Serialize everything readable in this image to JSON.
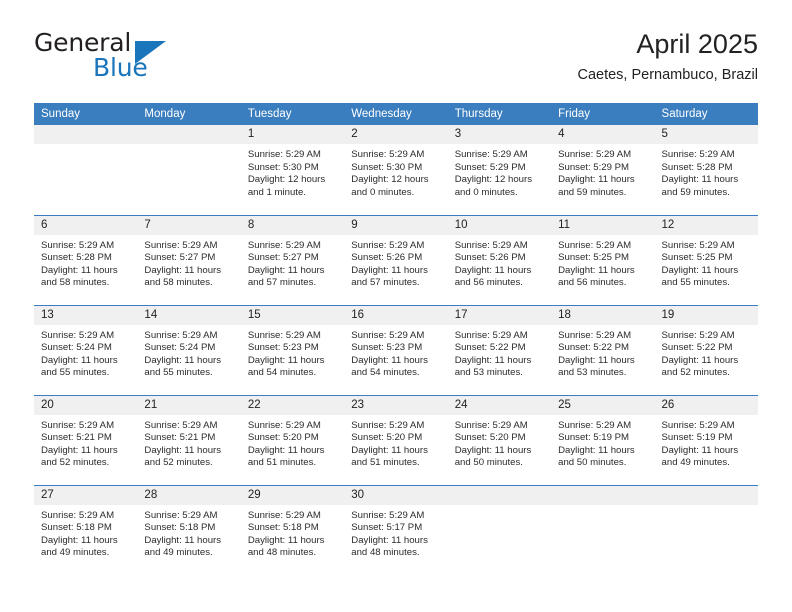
{
  "brand": {
    "name_top": "General",
    "name_bottom": "Blue",
    "flag_icon": "brand-flag-icon",
    "accent_color": "#1b75bb"
  },
  "header": {
    "month_title": "April 2025",
    "location": "Caetes, Pernambuco, Brazil"
  },
  "calendar": {
    "header_bg": "#3a7ebf",
    "daynum_bg": "#f0f0f0",
    "weekdays": [
      "Sunday",
      "Monday",
      "Tuesday",
      "Wednesday",
      "Thursday",
      "Friday",
      "Saturday"
    ],
    "weeks": [
      [
        {
          "empty": true
        },
        {
          "empty": true
        },
        {
          "day": "1",
          "sunrise": "Sunrise: 5:29 AM",
          "sunset": "Sunset: 5:30 PM",
          "daylight": "Daylight: 12 hours and 1 minute."
        },
        {
          "day": "2",
          "sunrise": "Sunrise: 5:29 AM",
          "sunset": "Sunset: 5:30 PM",
          "daylight": "Daylight: 12 hours and 0 minutes."
        },
        {
          "day": "3",
          "sunrise": "Sunrise: 5:29 AM",
          "sunset": "Sunset: 5:29 PM",
          "daylight": "Daylight: 12 hours and 0 minutes."
        },
        {
          "day": "4",
          "sunrise": "Sunrise: 5:29 AM",
          "sunset": "Sunset: 5:29 PM",
          "daylight": "Daylight: 11 hours and 59 minutes."
        },
        {
          "day": "5",
          "sunrise": "Sunrise: 5:29 AM",
          "sunset": "Sunset: 5:28 PM",
          "daylight": "Daylight: 11 hours and 59 minutes."
        }
      ],
      [
        {
          "day": "6",
          "sunrise": "Sunrise: 5:29 AM",
          "sunset": "Sunset: 5:28 PM",
          "daylight": "Daylight: 11 hours and 58 minutes."
        },
        {
          "day": "7",
          "sunrise": "Sunrise: 5:29 AM",
          "sunset": "Sunset: 5:27 PM",
          "daylight": "Daylight: 11 hours and 58 minutes."
        },
        {
          "day": "8",
          "sunrise": "Sunrise: 5:29 AM",
          "sunset": "Sunset: 5:27 PM",
          "daylight": "Daylight: 11 hours and 57 minutes."
        },
        {
          "day": "9",
          "sunrise": "Sunrise: 5:29 AM",
          "sunset": "Sunset: 5:26 PM",
          "daylight": "Daylight: 11 hours and 57 minutes."
        },
        {
          "day": "10",
          "sunrise": "Sunrise: 5:29 AM",
          "sunset": "Sunset: 5:26 PM",
          "daylight": "Daylight: 11 hours and 56 minutes."
        },
        {
          "day": "11",
          "sunrise": "Sunrise: 5:29 AM",
          "sunset": "Sunset: 5:25 PM",
          "daylight": "Daylight: 11 hours and 56 minutes."
        },
        {
          "day": "12",
          "sunrise": "Sunrise: 5:29 AM",
          "sunset": "Sunset: 5:25 PM",
          "daylight": "Daylight: 11 hours and 55 minutes."
        }
      ],
      [
        {
          "day": "13",
          "sunrise": "Sunrise: 5:29 AM",
          "sunset": "Sunset: 5:24 PM",
          "daylight": "Daylight: 11 hours and 55 minutes."
        },
        {
          "day": "14",
          "sunrise": "Sunrise: 5:29 AM",
          "sunset": "Sunset: 5:24 PM",
          "daylight": "Daylight: 11 hours and 55 minutes."
        },
        {
          "day": "15",
          "sunrise": "Sunrise: 5:29 AM",
          "sunset": "Sunset: 5:23 PM",
          "daylight": "Daylight: 11 hours and 54 minutes."
        },
        {
          "day": "16",
          "sunrise": "Sunrise: 5:29 AM",
          "sunset": "Sunset: 5:23 PM",
          "daylight": "Daylight: 11 hours and 54 minutes."
        },
        {
          "day": "17",
          "sunrise": "Sunrise: 5:29 AM",
          "sunset": "Sunset: 5:22 PM",
          "daylight": "Daylight: 11 hours and 53 minutes."
        },
        {
          "day": "18",
          "sunrise": "Sunrise: 5:29 AM",
          "sunset": "Sunset: 5:22 PM",
          "daylight": "Daylight: 11 hours and 53 minutes."
        },
        {
          "day": "19",
          "sunrise": "Sunrise: 5:29 AM",
          "sunset": "Sunset: 5:22 PM",
          "daylight": "Daylight: 11 hours and 52 minutes."
        }
      ],
      [
        {
          "day": "20",
          "sunrise": "Sunrise: 5:29 AM",
          "sunset": "Sunset: 5:21 PM",
          "daylight": "Daylight: 11 hours and 52 minutes."
        },
        {
          "day": "21",
          "sunrise": "Sunrise: 5:29 AM",
          "sunset": "Sunset: 5:21 PM",
          "daylight": "Daylight: 11 hours and 52 minutes."
        },
        {
          "day": "22",
          "sunrise": "Sunrise: 5:29 AM",
          "sunset": "Sunset: 5:20 PM",
          "daylight": "Daylight: 11 hours and 51 minutes."
        },
        {
          "day": "23",
          "sunrise": "Sunrise: 5:29 AM",
          "sunset": "Sunset: 5:20 PM",
          "daylight": "Daylight: 11 hours and 51 minutes."
        },
        {
          "day": "24",
          "sunrise": "Sunrise: 5:29 AM",
          "sunset": "Sunset: 5:20 PM",
          "daylight": "Daylight: 11 hours and 50 minutes."
        },
        {
          "day": "25",
          "sunrise": "Sunrise: 5:29 AM",
          "sunset": "Sunset: 5:19 PM",
          "daylight": "Daylight: 11 hours and 50 minutes."
        },
        {
          "day": "26",
          "sunrise": "Sunrise: 5:29 AM",
          "sunset": "Sunset: 5:19 PM",
          "daylight": "Daylight: 11 hours and 49 minutes."
        }
      ],
      [
        {
          "day": "27",
          "sunrise": "Sunrise: 5:29 AM",
          "sunset": "Sunset: 5:18 PM",
          "daylight": "Daylight: 11 hours and 49 minutes."
        },
        {
          "day": "28",
          "sunrise": "Sunrise: 5:29 AM",
          "sunset": "Sunset: 5:18 PM",
          "daylight": "Daylight: 11 hours and 49 minutes."
        },
        {
          "day": "29",
          "sunrise": "Sunrise: 5:29 AM",
          "sunset": "Sunset: 5:18 PM",
          "daylight": "Daylight: 11 hours and 48 minutes."
        },
        {
          "day": "30",
          "sunrise": "Sunrise: 5:29 AM",
          "sunset": "Sunset: 5:17 PM",
          "daylight": "Daylight: 11 hours and 48 minutes."
        },
        {
          "empty": true
        },
        {
          "empty": true
        },
        {
          "empty": true
        }
      ]
    ]
  }
}
